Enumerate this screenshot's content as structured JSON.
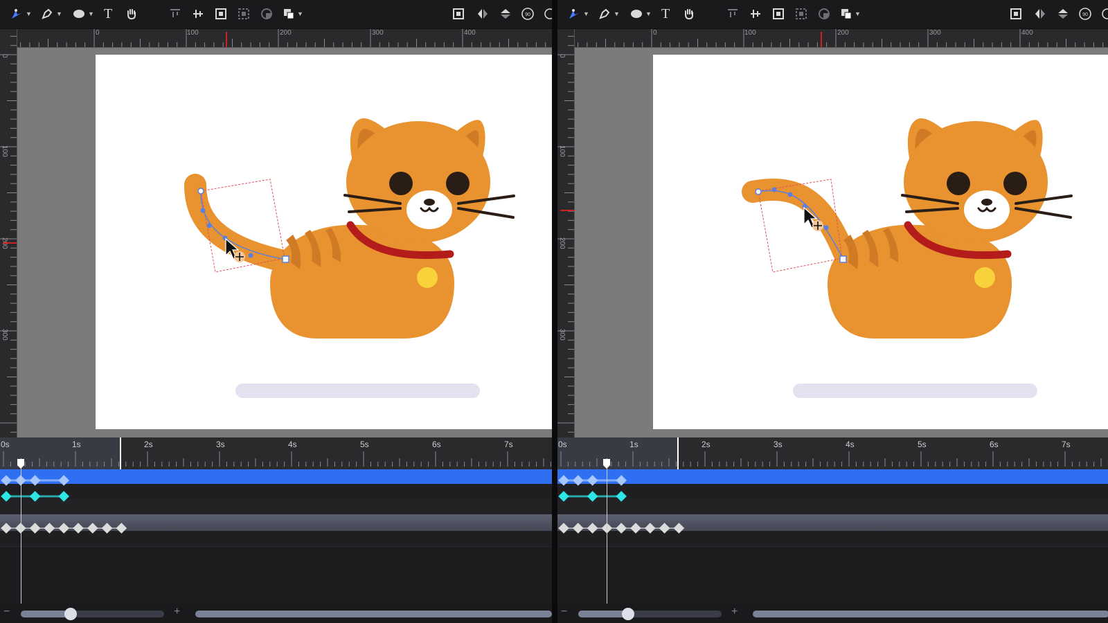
{
  "colors": {
    "accent_blue": "#2f6ff2",
    "keyframe_blue": "#a8c6ff",
    "keyframe_cyan": "#2ee6e6",
    "keyframe_white": "#dcdcdc",
    "cat_orange": "#e8932f",
    "cat_stripe": "#cf7a24",
    "collar": "#b41c1c",
    "bell": "#f8d23a",
    "eye": "#2a1d16",
    "shadow": "#e2e2f0",
    "selection_red": "#e0505a",
    "path_blue": "#5b7fe0"
  },
  "toolbar": {
    "tools": [
      {
        "icon": "node-select-icon"
      },
      {
        "icon": "pen-icon"
      },
      {
        "icon": "ellipse-icon"
      },
      {
        "icon": "text-icon",
        "label": "T"
      },
      {
        "icon": "hand-icon"
      }
    ],
    "align_tools": [
      {
        "icon": "align-top-icon"
      },
      {
        "icon": "align-middle-icon"
      },
      {
        "icon": "group-icon"
      },
      {
        "icon": "ungroup-icon"
      },
      {
        "icon": "mask-icon"
      },
      {
        "icon": "boolean-icon"
      }
    ],
    "right_tools": [
      {
        "icon": "fit-icon"
      },
      {
        "icon": "flip-horizontal-icon"
      },
      {
        "icon": "flip-vertical-icon"
      },
      {
        "icon": "rotate-90-icon",
        "label": "90"
      }
    ]
  },
  "rulers": {
    "top_labels": [
      "0",
      "100",
      "200",
      "300",
      "400"
    ],
    "left_labels": [
      "0",
      "100",
      "200",
      "300"
    ]
  },
  "timeline": {
    "time_labels": [
      "0s",
      "1s",
      "2s",
      "3s",
      "4s",
      "5s",
      "6s",
      "7s"
    ],
    "work_area_end": "1.6s",
    "tracks": [
      {
        "name": "position-track",
        "color": "blue",
        "keyframes": [
          0,
          0.2,
          0.4,
          0.8
        ]
      },
      {
        "name": "rotation-track",
        "color": "cyan",
        "keyframes": [
          0,
          0.4,
          0.8
        ]
      },
      {
        "name": "shape-track",
        "color": "white",
        "keyframes": [
          0,
          0.2,
          0.4,
          0.6,
          0.8,
          1.0,
          1.2,
          1.4,
          1.6
        ]
      }
    ]
  },
  "panels": [
    {
      "name": "before",
      "playhead_time": "0.2s",
      "tail_pose": "down"
    },
    {
      "name": "after",
      "playhead_time": "0.6s",
      "tail_pose": "up"
    }
  ],
  "zoom": {
    "minus_label": "−",
    "plus_label": "+",
    "level_fraction": 0.35
  }
}
